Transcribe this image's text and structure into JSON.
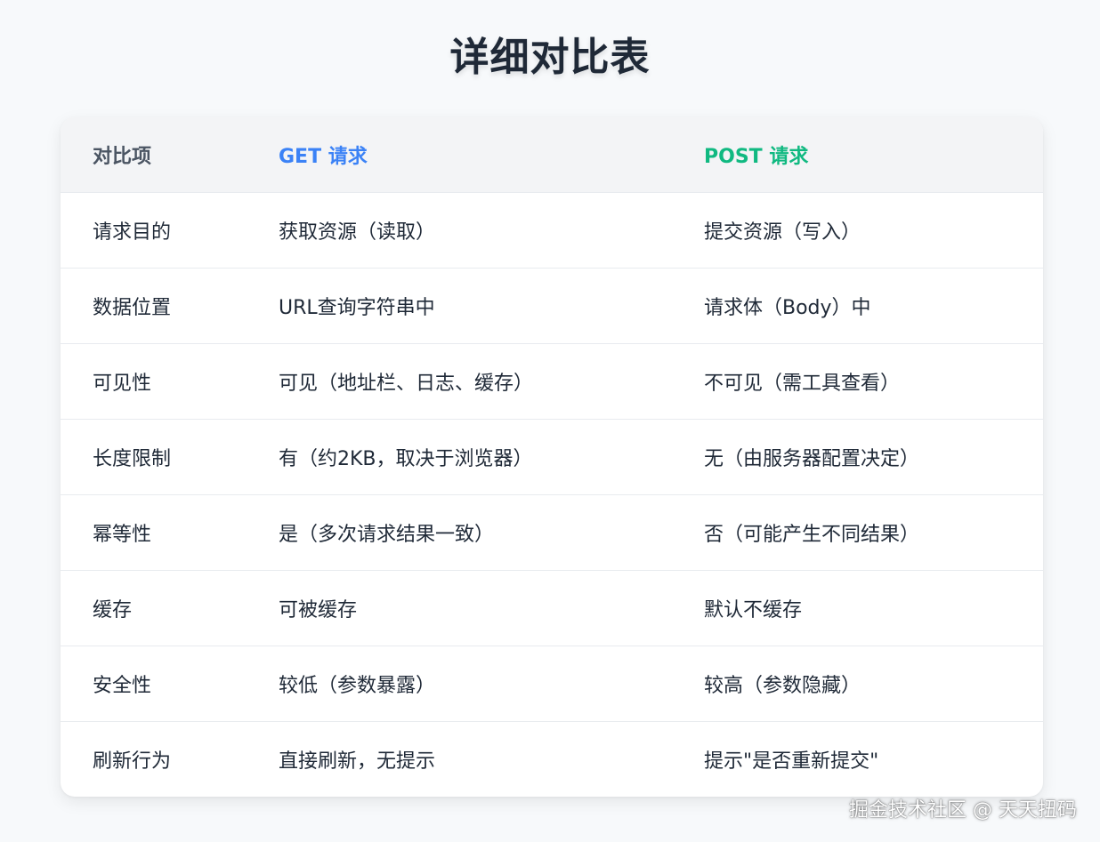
{
  "title": "详细对比表",
  "table": {
    "headers": [
      "对比项",
      "GET 请求",
      "POST 请求"
    ],
    "header_colors": [
      "#4b5563",
      "#3b82f6",
      "#10b981"
    ],
    "rows": [
      [
        "请求目的",
        "获取资源（读取）",
        "提交资源（写入）"
      ],
      [
        "数据位置",
        "URL查询字符串中",
        "请求体（Body）中"
      ],
      [
        "可见性",
        "可见（地址栏、日志、缓存）",
        "不可见（需工具查看）"
      ],
      [
        "长度限制",
        "有（约2KB，取决于浏览器）",
        "无（由服务器配置决定）"
      ],
      [
        "幂等性",
        "是（多次请求结果一致）",
        "否（可能产生不同结果）"
      ],
      [
        "缓存",
        "可被缓存",
        "默认不缓存"
      ],
      [
        "安全性",
        "较低（参数暴露）",
        "较高（参数隐藏）"
      ],
      [
        "刷新行为",
        "直接刷新，无提示",
        "提示\"是否重新提交\""
      ]
    ]
  },
  "watermark": "掘金技术社区 @ 天天扭码"
}
